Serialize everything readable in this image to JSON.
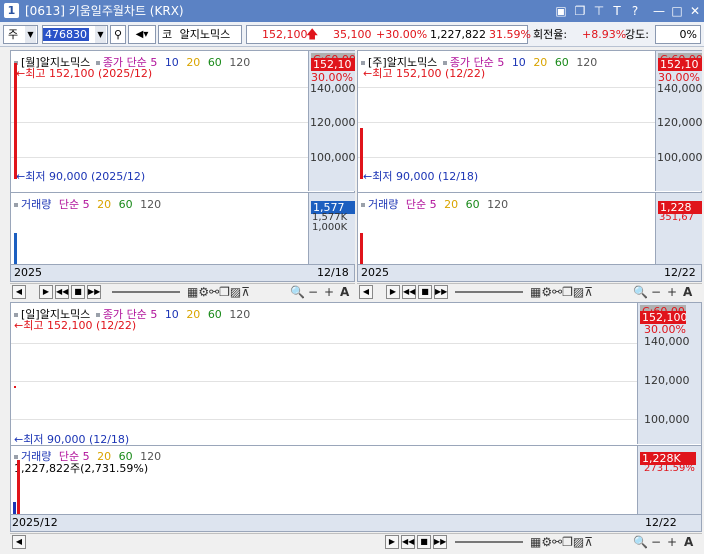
{
  "window": {
    "number": "1",
    "title": "[0613] 키움일주월차트 (KRX)"
  },
  "toolbar": {
    "market_select": "주",
    "stock_code": "476830",
    "code_prefix": "코",
    "stock_name": "알지노믹스",
    "price": "152,100",
    "change": "35,100",
    "change_pct": "+30.00%",
    "volume": "1,227,822",
    "volume_ratio": "31.59%",
    "turnover_label": "회전율:",
    "turnover": "+8.93%",
    "strength_label": "강도:",
    "strength": "0%"
  },
  "monthly": {
    "legend": {
      "title": "[월]알지노믹스",
      "close": "종가",
      "simple": "단순",
      "ma5": "5",
      "ma10": "10",
      "ma20": "20",
      "ma60": "60",
      "ma120": "120"
    },
    "high": "최고 152,100 (2025/12)",
    "low": "최저 90,000 (2025/12)",
    "price_box": "152,10",
    "price_box_top": "C:60,00",
    "pct_box": "30.00%",
    "axis": [
      "140,000",
      "120,000",
      "100,000"
    ],
    "vol_legend": {
      "title": "거래량",
      "simple": "단순",
      "ma5": "5",
      "ma20": "20",
      "ma60": "60",
      "ma120": "120"
    },
    "vol_box": "1,577",
    "vol_axis": [
      "1,577K",
      "1,000K"
    ],
    "date_left": "2025",
    "date_right": "12/18"
  },
  "weekly": {
    "legend": {
      "title": "[주]알지노믹스",
      "close": "종가",
      "simple": "단순",
      "ma5": "5",
      "ma10": "10",
      "ma20": "20",
      "ma60": "60",
      "ma120": "120"
    },
    "high": "최고 152,100 (12/22)",
    "low": "최저 90,000 (12/18)",
    "price_box": "152,10",
    "price_box_top": "C:60,00",
    "pct_box": "30.00%",
    "axis": [
      "140,000",
      "120,000",
      "100,000"
    ],
    "vol_legend": {
      "title": "거래량",
      "simple": "단순",
      "ma5": "5",
      "ma20": "20",
      "ma60": "60",
      "ma120": "120"
    },
    "vol_box": "1,228",
    "vol_axis": [
      "351,67"
    ],
    "date_left": "2025",
    "date_right": "12/22"
  },
  "daily": {
    "legend": {
      "title": "[일]알지노믹스",
      "close": "종가",
      "simple": "단순",
      "ma5": "5",
      "ma10": "10",
      "ma20": "20",
      "ma60": "60",
      "ma120": "120"
    },
    "high": "최고 152,100 (12/22)",
    "low": "최저 90,000 (12/18)",
    "price_box": "152,100",
    "price_box_top": "C:60,00",
    "pct_box": "30.00%",
    "axis": [
      "140,000",
      "120,000",
      "100,000"
    ],
    "vol_legend": {
      "title": "거래량",
      "simple": "단순",
      "ma5": "5",
      "ma20": "20",
      "ma60": "60",
      "ma120": "120"
    },
    "vol_info": "1,227,822주(2,731.59%)",
    "vol_box": "1,228K",
    "vol_axis": [
      "2731.59%"
    ],
    "date_left": "2025/12",
    "date_right": "12/22"
  },
  "controls": {
    "first": "◀",
    "play": "▶",
    "back": "◀◀",
    "stop": "■",
    "forward": "▶▶",
    "minus": "−",
    "plus": "+",
    "auto": "A",
    "search": "🔍"
  }
}
